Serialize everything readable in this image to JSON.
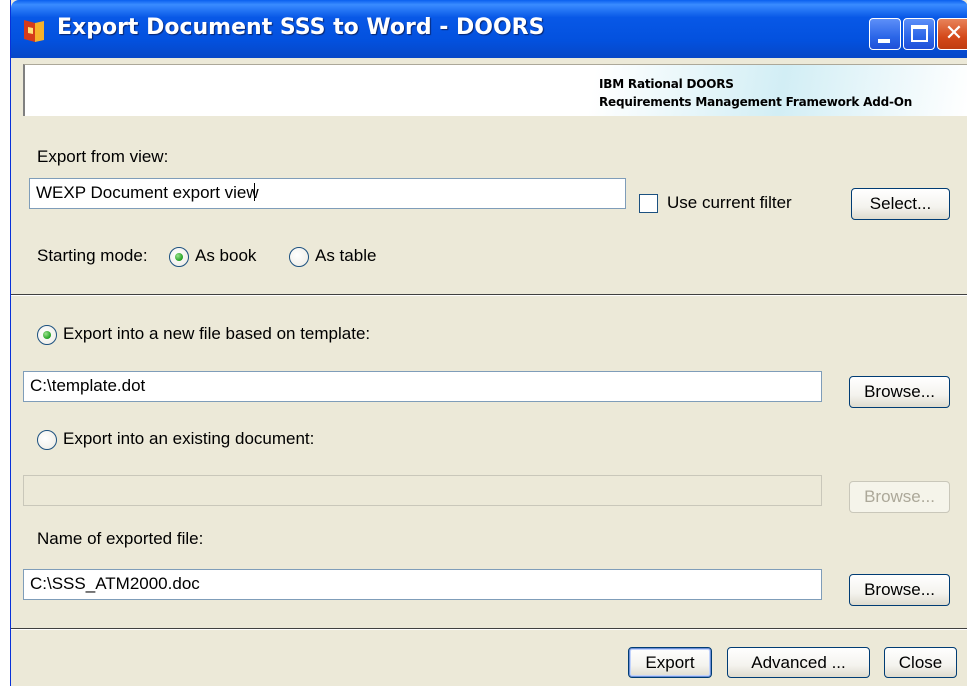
{
  "window": {
    "title": "Export Document SSS to Word - DOORS",
    "app_icon": "doors-app-icon",
    "controls": {
      "minimize_icon": "minimize-icon",
      "maximize_icon": "maximize-icon",
      "close_icon": "close-icon",
      "close_glyph": "✕"
    }
  },
  "banner": {
    "line1": "IBM Rational DOORS",
    "line2": "Requirements Management Framework Add-On"
  },
  "view_section": {
    "export_from_view_label": "Export from view:",
    "view_value": "WEXP Document export view",
    "use_current_filter_label": "Use current filter",
    "use_current_filter_checked": false,
    "select_button": "Select...",
    "starting_mode_label": "Starting mode:",
    "modes": [
      {
        "label": "As book",
        "selected": true
      },
      {
        "label": "As table",
        "selected": false
      }
    ]
  },
  "file_section": {
    "new_file_option": {
      "label": "Export into a new file based on template:",
      "selected": true
    },
    "template_path": "C:\\template.dot",
    "browse_template": "Browse...",
    "existing_doc_option": {
      "label": "Export into an existing document:",
      "selected": false
    },
    "existing_doc_path": "",
    "browse_existing": "Browse...",
    "exported_name_label": "Name of exported file:",
    "exported_name_value": "C:\\SSS_ATM2000.doc",
    "browse_exported": "Browse..."
  },
  "footer": {
    "export_button": "Export",
    "advanced_button": "Advanced ...",
    "close_button": "Close"
  },
  "colors": {
    "titlebar": "#0858e7",
    "dialog_bg": "#ece9d8",
    "radio_selected": "#21a121"
  }
}
